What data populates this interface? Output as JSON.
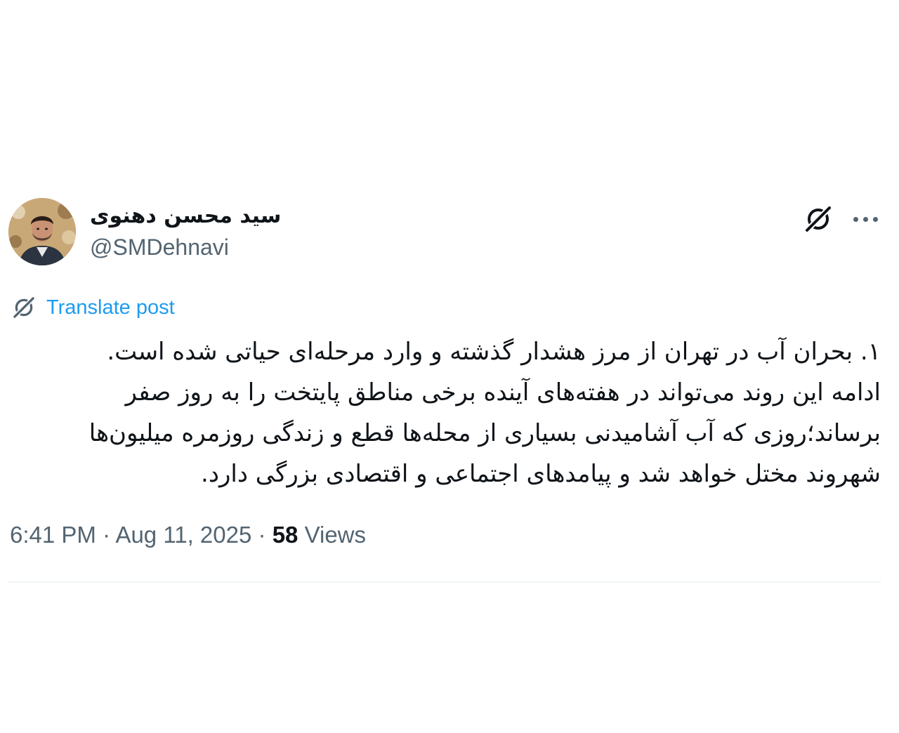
{
  "post": {
    "author": {
      "display_name": "سید محسن دهنوی",
      "handle": "@SMDehnavi",
      "avatar_icon": "avatar-photo"
    },
    "actions": {
      "grok_icon": "grok-icon",
      "more_icon": "more-options-icon"
    },
    "translate_label": "Translate post",
    "text_lines": [
      "۱. بحران آب در تهران از مرز هشدار گذشته و وارد مرحله‌ای حیاتی شده است.",
      "ادامه این روند می‌تواند در هفته‌های آینده برخی مناطق پایتخت را به روز صفر",
      "برساند؛روزی که آب آشامیدنی بسیاری از محله‌ها قطع و زندگی روزمره میلیون‌ها",
      "شهروند مختل خواهد شد و پیامدهای اجتماعی و اقتصادی بزرگی دارد."
    ],
    "time": "6:41 PM",
    "separator": "·",
    "date": "Aug 11, 2025",
    "views_count": "58",
    "views_label": "Views"
  },
  "colors": {
    "text_primary": "#0f1419",
    "text_secondary": "#536471",
    "link_blue": "#1d9bf0",
    "divider": "#eff3f4"
  }
}
